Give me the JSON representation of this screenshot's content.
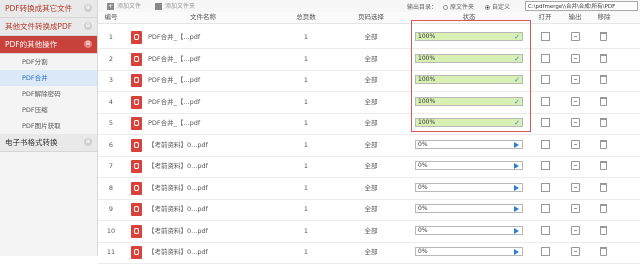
{
  "sidebar": {
    "sections": [
      {
        "label": "PDF转换成其它文件",
        "toggle": "⊕"
      },
      {
        "label": "其他文件转换成PDF",
        "toggle": "⊕"
      },
      {
        "label": "PDF的其他操作",
        "toggle": "⊖"
      },
      {
        "label": "电子书格式转换",
        "toggle": "⊕"
      }
    ],
    "items": [
      "PDF分割",
      "PDF合并",
      "PDF解除密码",
      "PDF压缩",
      "PDF图片获取"
    ]
  },
  "toolbar": {
    "add_file": "添加文件",
    "add_folder": "添加文件夹",
    "output_label": "输出目录：",
    "radio_original": "原文件夹",
    "radio_custom": "自定义",
    "path": "C:\\pdfmerge\\\\合并\\合成\\所有\\PDF"
  },
  "table": {
    "headers": [
      "编号",
      "文件名称",
      "总页数",
      "页码选择",
      "状态",
      "打开",
      "输出",
      "移除"
    ],
    "rows": [
      {
        "num": "1",
        "name": "PDF合并_【...pdf",
        "pages": "1",
        "range": "全部",
        "status": "100%",
        "done": true
      },
      {
        "num": "2",
        "name": "PDF合并_【...pdf",
        "pages": "1",
        "range": "全部",
        "status": "100%",
        "done": true
      },
      {
        "num": "3",
        "name": "PDF合并_【...pdf",
        "pages": "1",
        "range": "全部",
        "status": "100%",
        "done": true
      },
      {
        "num": "4",
        "name": "PDF合并_【...pdf",
        "pages": "1",
        "range": "全部",
        "status": "100%",
        "done": true
      },
      {
        "num": "5",
        "name": "PDF合并_【...pdf",
        "pages": "1",
        "range": "全部",
        "status": "100%",
        "done": true
      },
      {
        "num": "6",
        "name": "【考前资料】0...pdf",
        "pages": "1",
        "range": "全部",
        "status": "0%",
        "done": false
      },
      {
        "num": "7",
        "name": "【考前资料】0...pdf",
        "pages": "1",
        "range": "全部",
        "status": "0%",
        "done": false
      },
      {
        "num": "8",
        "name": "【考前资料】0...pdf",
        "pages": "1",
        "range": "全部",
        "status": "0%",
        "done": false
      },
      {
        "num": "9",
        "name": "【考前资料】0...pdf",
        "pages": "1",
        "range": "全部",
        "status": "0%",
        "done": false
      },
      {
        "num": "10",
        "name": "【考前资料】0...pdf",
        "pages": "1",
        "range": "全部",
        "status": "0%",
        "done": false
      },
      {
        "num": "11",
        "name": "【考前资料】0...pdf",
        "pages": "1",
        "range": "全部",
        "status": "0%",
        "done": false
      }
    ]
  },
  "colors": {
    "accent_red": "#c8413b",
    "progress_fill": "#d9f0b4",
    "icon_blue": "#2b7fd0"
  }
}
